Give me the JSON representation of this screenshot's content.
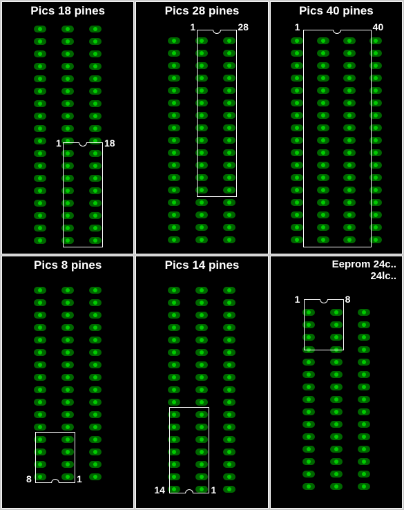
{
  "cells": [
    {
      "title": "Pics 18 pines",
      "pin_left": "1",
      "pin_right": "18"
    },
    {
      "title": "Pics 28 pines",
      "pin_left": "1",
      "pin_right": "28"
    },
    {
      "title": "Pics 40 pines",
      "pin_left": "1",
      "pin_right": "40"
    },
    {
      "title": "Pics 8 pines",
      "pin_left": "8",
      "pin_right": "1"
    },
    {
      "title": "Pics 14 pines",
      "pin_left": "14",
      "pin_right": "1"
    },
    {
      "title_a": "Eeprom  24c..",
      "title_b": "24lc..",
      "pin_left": "1",
      "pin_right": "8"
    }
  ],
  "chart_data": [
    {
      "type": "table",
      "label": "Pics 18 pines",
      "pin_count": 18,
      "pin1_label_pos": "left-top",
      "pinN_label_pos": "right-top",
      "columns": 3,
      "rows_visible": 18,
      "notch": "top"
    },
    {
      "type": "table",
      "label": "Pics 28 pines",
      "pin_count": 28,
      "pin1_label_pos": "left-top",
      "pinN_label_pos": "right-top",
      "columns": 3,
      "rows_visible": 18,
      "notch": "top"
    },
    {
      "type": "table",
      "label": "Pics 40 pines",
      "pin_count": 40,
      "pin1_label_pos": "left-top",
      "pinN_label_pos": "right-top",
      "columns": 4,
      "rows_visible": 18,
      "notch": "top"
    },
    {
      "type": "table",
      "label": "Pics 8 pines",
      "pin_count": 8,
      "pin1_label_pos": "right-bottom",
      "pinN_label_pos": "left-bottom",
      "columns": 3,
      "rows_visible": 16,
      "notch": "bottom"
    },
    {
      "type": "table",
      "label": "Pics 14 pines",
      "pin_count": 14,
      "pin1_label_pos": "right-bottom",
      "pinN_label_pos": "left-bottom",
      "columns": 3,
      "rows_visible": 17,
      "notch": "bottom"
    },
    {
      "type": "table",
      "label": "Eeprom 24c.. 24lc..",
      "pin_count": 8,
      "pin1_label_pos": "left-top",
      "pinN_label_pos": "right-top",
      "columns": 3,
      "rows_visible": 15,
      "notch": "top"
    }
  ]
}
